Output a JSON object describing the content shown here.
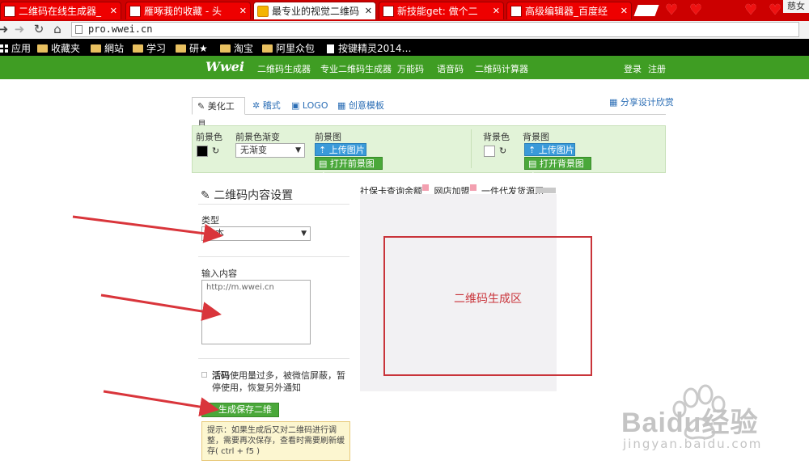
{
  "browser": {
    "tabs": [
      {
        "title": "二维码在线生成器_",
        "active": false
      },
      {
        "title": "雁啄莪的收藏 - 头",
        "active": false
      },
      {
        "title": "最专业的视觉二维码",
        "active": true
      },
      {
        "title": "新技能get: 做个二",
        "active": false
      },
      {
        "title": "高级编辑器_百度经",
        "active": false
      }
    ],
    "corner_text": "慈女",
    "url": "pro.wwei.cn",
    "bookmarks": [
      {
        "label": "应用",
        "icon": "apps-grid-icon"
      },
      {
        "label": "收藏夹",
        "icon": "folder-icon"
      },
      {
        "label": "網站",
        "icon": "folder-icon"
      },
      {
        "label": "学习",
        "icon": "folder-icon"
      },
      {
        "label": "研★",
        "icon": "folder-icon"
      },
      {
        "label": "淘宝",
        "icon": "folder-icon"
      },
      {
        "label": "阿里众包",
        "icon": "folder-icon"
      },
      {
        "label": "按键精灵2014…",
        "icon": "page-icon"
      }
    ]
  },
  "site": {
    "logo": "Wwei",
    "nav": [
      "二维码生成器",
      "专业二维码生成器",
      "万能码",
      "语音码",
      "二维码计算器"
    ],
    "login": "登录",
    "register": "注册"
  },
  "tool_tabs": [
    {
      "label": "美化工具",
      "icon": "brush-icon",
      "active": true
    },
    {
      "label": "稽式",
      "icon": "gear-icon",
      "active": false
    },
    {
      "label": "LOGO",
      "icon": "image-icon",
      "active": false
    },
    {
      "label": "创意模板",
      "icon": "grid-icon",
      "active": false
    }
  ],
  "share_link": "分享设计欣赏",
  "style_panel": {
    "fg_color_label": "前景色",
    "fg_color": "#000000",
    "fg_gradient_label": "前景色渐变",
    "fg_gradient_value": "无渐变",
    "fg_image_label": "前景图",
    "fg_upload": "上传图片",
    "fg_gallery": "打开前景图库",
    "bg_color_label": "背景色",
    "bg_color": "#ffffff",
    "bg_image_label": "背景图",
    "bg_upload": "上传图片",
    "bg_gallery": "打开背景图库"
  },
  "content_settings": {
    "title": "二维码内容设置",
    "type_label": "类型",
    "type_value": "文本",
    "input_label": "输入内容",
    "input_placeholder": "http://m.wwei.cn",
    "note_bold": "活码",
    "note_text": "使用量过多，被微信屏蔽，暂停使用，恢复另外通知",
    "generate_button": "生成保存二维码",
    "tip": "提示：如果生成后又对二维码进行调整，需要再次保存，查看时需要刷新缓存( ctrl + f5 )"
  },
  "preview": {
    "ads": [
      "社保卡查询余额",
      "网店加盟",
      "一件代发货源网"
    ],
    "qr_area_label": "二维码生成区"
  },
  "watermark": {
    "brand": "Baidu经验",
    "url": "jingyan.baidu.com"
  },
  "colors": {
    "site_green": "#3f9d23",
    "tab_red": "#cc0000",
    "annotation_red": "#d9353b"
  }
}
